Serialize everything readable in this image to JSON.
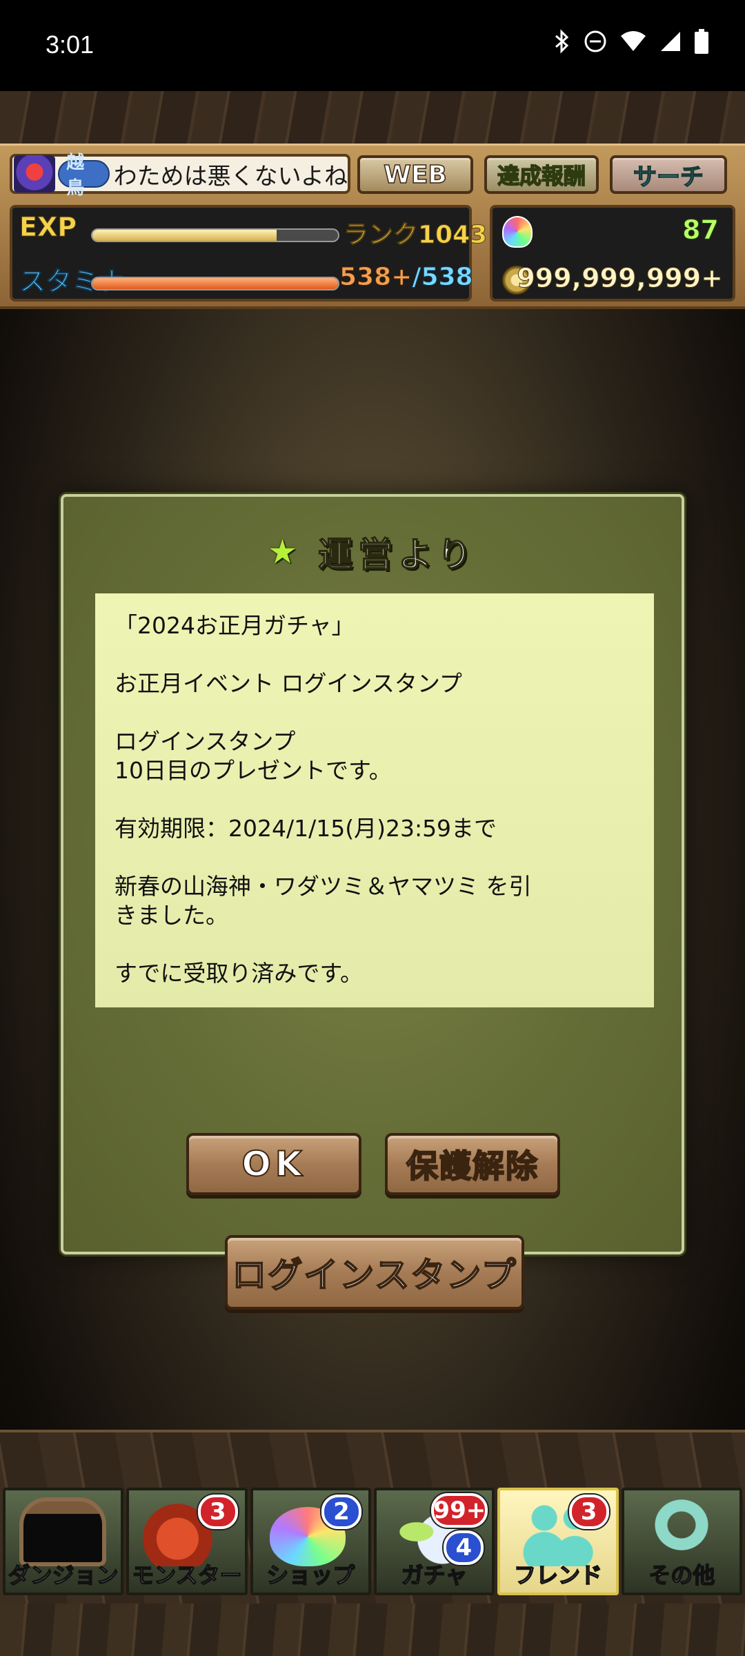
{
  "status_bar": {
    "time": "3:01",
    "icons": [
      "bluetooth-icon",
      "do-not-disturb-icon",
      "wifi-icon",
      "cellular-signal-icon",
      "battery-icon"
    ]
  },
  "hud": {
    "title_badge": "越鳥",
    "player_name": "わためは悪くないよね",
    "buttons": {
      "web": "WEB",
      "achievements": "達成報酬",
      "search": "サーチ"
    },
    "exp_label": "EXP",
    "exp_progress": 0.75,
    "rank_text": "ランク1043",
    "stamina_label": "スタミナ",
    "stamina_current": "538+",
    "stamina_max": "/538",
    "stamina_progress": 1.0,
    "magic_stones": "87",
    "coins": "999,999,999+"
  },
  "dialog": {
    "title": "運営より",
    "message": {
      "line1": "「2024お正月ガチャ」",
      "line2": "お正月イベント ログインスタンプ",
      "line3": "ログインスタンプ",
      "line4": "10日目のプレゼントです。",
      "line5": "有効期限：2024/1/15(月)23:59まで",
      "line6": "新春の山海神・ワダツミ＆ヤマツミ を引",
      "line7": "きました。",
      "line8": "すでに受取り済みです。"
    },
    "ok_button": "OK",
    "unprotect_button": "保護解除",
    "login_stamp_button": "ログインスタンプ"
  },
  "bottom_nav": {
    "items": [
      {
        "label": "ダンジョン",
        "badge": ""
      },
      {
        "label": "モンスター",
        "badge": "3"
      },
      {
        "label": "ショップ",
        "badge": "2"
      },
      {
        "label": "ガチャ",
        "badge": "99+",
        "badge2": "4"
      },
      {
        "label": "フレンド",
        "badge": "3"
      },
      {
        "label": "その他",
        "badge": ""
      }
    ],
    "active_index": 4
  },
  "colors": {
    "dialog_bg": "#656d37",
    "message_bg": "#eef4b4",
    "button_bg": "#a67c56",
    "badge_red": "#d2232a",
    "badge_blue": "#2a4fd0"
  }
}
